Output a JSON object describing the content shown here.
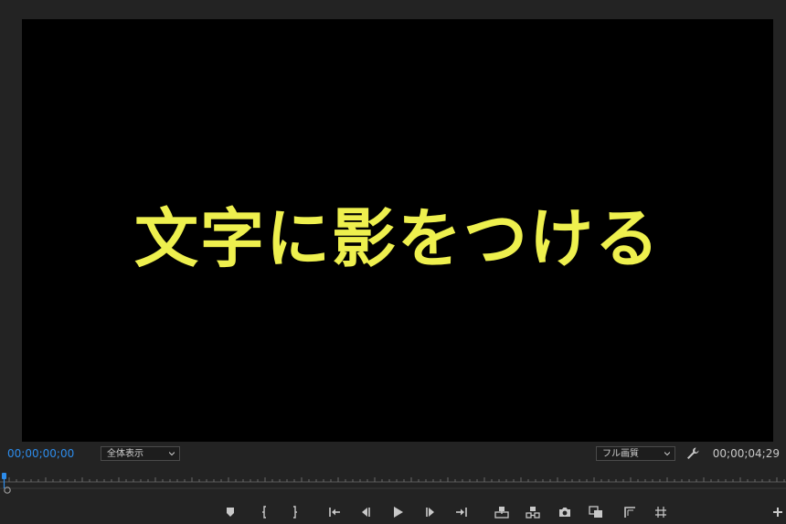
{
  "viewer": {
    "title_text": "文字に影をつける",
    "text_color": "#eef04e"
  },
  "infobar": {
    "current_timecode": "00;00;00;00",
    "duration_timecode": "00;00;04;29",
    "zoom_select": "全体表示",
    "quality_select": "フル画質"
  },
  "colors": {
    "accent": "#2d8ceb",
    "panel_bg": "#232323",
    "icon": "#c8c8c8"
  },
  "controls": [
    "add-marker-icon",
    "mark-in-icon",
    "mark-out-icon",
    "go-to-in-icon",
    "step-back-icon",
    "play-icon",
    "step-forward-icon",
    "go-to-out-icon",
    "lift-icon",
    "extract-icon",
    "export-frame-icon",
    "comparison-view-icon",
    "safe-margins-icon",
    "trim-icon",
    "add-button-icon"
  ]
}
